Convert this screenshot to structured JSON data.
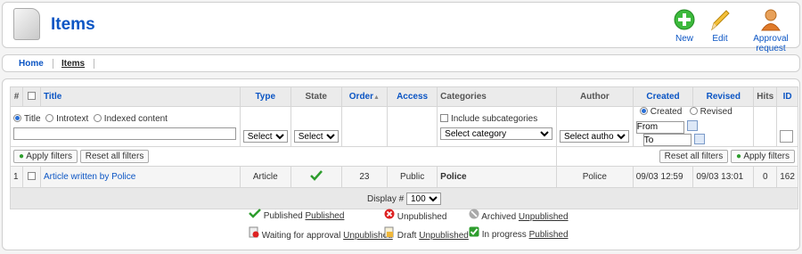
{
  "header": {
    "title": "Items"
  },
  "toolbar": {
    "new_label": "New",
    "edit_label": "Edit",
    "approval_label": "Approval request"
  },
  "nav": {
    "home": "Home",
    "items": "Items"
  },
  "table": {
    "headers": {
      "num": "#",
      "title": "Title",
      "type": "Type",
      "state": "State",
      "order": "Order",
      "access": "Access",
      "categories": "Categories",
      "author": "Author",
      "created": "Created",
      "revised": "Revised",
      "hits": "Hits",
      "id": "ID"
    },
    "filters": {
      "title_opt": "Title",
      "introtext_opt": "Introtext",
      "indexed_opt": "Indexed content",
      "type_select": "Select",
      "state_select": "Select",
      "include_sub": "Include subcategories",
      "category_select": "Select category",
      "author_select": "Select author",
      "created_opt": "Created",
      "revised_opt": "Revised",
      "from_value": "From",
      "to_value": "To"
    },
    "buttons": {
      "apply_left": "Apply filters",
      "reset_left": "Reset all filters",
      "reset_right": "Reset all filters",
      "apply_right": "Apply filters"
    },
    "row": {
      "num": "1",
      "title": "Article written by Police",
      "type": "Article",
      "order": "23",
      "access": "Public",
      "category": "Police",
      "author": "Police",
      "created": "09/03 12:59",
      "revised": "09/03 13:01",
      "hits": "0",
      "id": "162"
    },
    "display_label": "Display #",
    "display_value": "100"
  },
  "legend": {
    "published": "Published",
    "published_link": "Published",
    "unpublished": "Unpublished",
    "archived": "Archived",
    "archived_link": "Unpublished",
    "waiting": "Waiting for approval",
    "waiting_link": "Unpublished",
    "draft": "Draft",
    "draft_link": "Unpublished",
    "inprogress": "In progress",
    "inprogress_link": "Published"
  },
  "colors": {
    "link": "#0b55c4",
    "green": "#2e9d2e",
    "red": "#d22"
  }
}
